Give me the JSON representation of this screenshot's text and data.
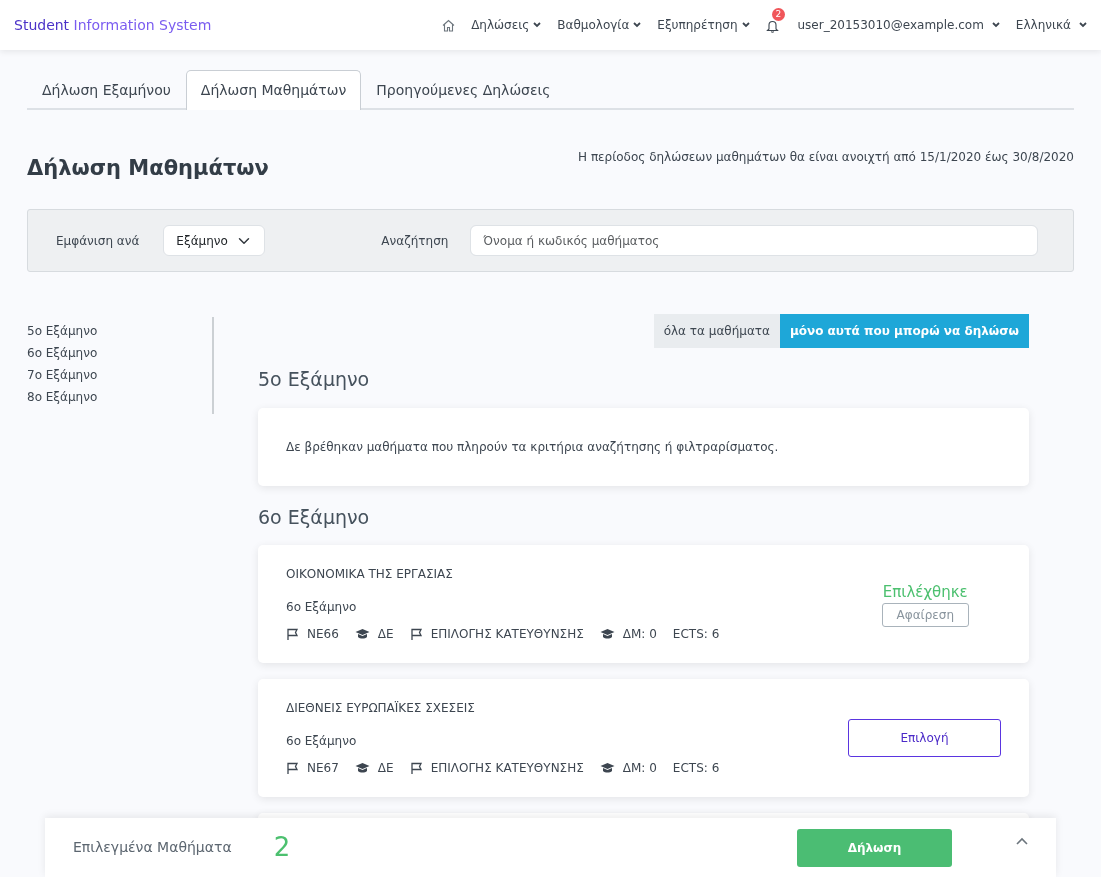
{
  "navbar": {
    "brand": "**Student** Information System",
    "menus": [
      {
        "label": "Δηλώσεις"
      },
      {
        "label": "Βαθμολογία"
      },
      {
        "label": "Εξυπηρέτηση"
      }
    ],
    "notifications": "2",
    "user": "user_20153010@example.com",
    "language": "Ελληνικά"
  },
  "tabs": [
    {
      "label": "Δήλωση Εξαμήνου",
      "selected": false
    },
    {
      "label": "Δήλωση Μαθημάτων",
      "selected": true
    },
    {
      "label": "Προηγούμενες Δηλώσεις",
      "selected": false
    }
  ],
  "page_title": "Δήλωση Μαθημάτων",
  "period_note": "Η περίοδος δηλώσεων μαθημάτων θα είναι ανοιχτή από 15/1/2020 έως 30/8/2020",
  "filters": {
    "show_by_label": "Εμφάνιση ανά",
    "show_by_value": "Εξάμηνο",
    "search_label": "Αναζήτηση",
    "search_placeholder": "Όνομα ή κωδικός μαθήματος"
  },
  "sidebar": {
    "items": [
      "5ο Εξάμηνο",
      "6ο Εξάμηνο",
      "7ο Εξάμηνο",
      "8ο Εξάμηνο"
    ]
  },
  "toggle": [
    {
      "label": "όλα τα μαθήματα",
      "selected": false
    },
    {
      "label": "μόνο αυτά που μπορώ να δηλώσω",
      "selected": true
    }
  ],
  "sections": [
    {
      "title": "5ο Εξάμηνο",
      "empty_message": "Δε βρέθηκαν μαθήματα που πληρούν τα κριτήρια αναζήτησης ή φιλτραρίσματος."
    },
    {
      "title": "6ο Εξάμηνο",
      "courses": [
        {
          "kind": "course",
          "title": "ΟΙΚΟΝΟΜΙΚΑ ΤΗΣ ΕΡΓΑΣΙΑΣ",
          "semester": "6ο Εξάμηνο",
          "code": "ΝΕ66",
          "type": "ΔΕ",
          "category": "ΕΠΙΛΟΓΗΣ ΚΑΤΕΥΘΥΝΣΗΣ",
          "dm": "ΔΜ: 0",
          "ects": "ECTS: 6",
          "selected": true,
          "status": "Επιλέχθηκε",
          "action": "Αφαίρεση"
        },
        {
          "kind": "course",
          "title": "ΔΙΕΘΝΕΙΣ ΕΥΡΩΠΑΪΚΕΣ ΣΧΕΣΕΙΣ",
          "semester": "6ο Εξάμηνο",
          "code": "ΝΕ67",
          "type": "ΔΕ",
          "category": "ΕΠΙΛΟΓΗΣ ΚΑΤΕΥΘΥΝΣΗΣ",
          "dm": "ΔΜ: 0",
          "ects": "ECTS: 6",
          "selected": false,
          "action": "Επιλογή"
        },
        {
          "kind": "hidden"
        }
      ]
    }
  ],
  "footer": {
    "label": "Επιλεγμένα Μαθήματα",
    "count": "2",
    "submit": "Δήλωση"
  }
}
